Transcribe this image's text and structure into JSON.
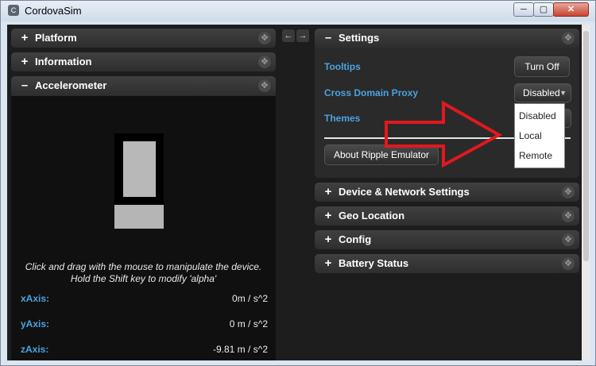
{
  "window": {
    "title": "CordovaSim",
    "minimize": "─",
    "maximize": "▢",
    "close": "✕",
    "app_icon": "C"
  },
  "left_panels": {
    "platform": {
      "label": "Platform",
      "sign": "+"
    },
    "information": {
      "label": "Information",
      "sign": "+"
    },
    "accelerometer": {
      "label": "Accelerometer",
      "sign": "–"
    },
    "drag_glyph": "✥"
  },
  "accelerometer": {
    "hint_line1": "Click and drag with the mouse to manipulate the device.",
    "hint_line2": "Hold the Shift key to modify 'alpha'",
    "x_label": "xAxis:",
    "x_value": "0m / s^2",
    "y_label": "yAxis:",
    "y_value": "0 m / s^2",
    "z_label": "zAxis:",
    "z_value": "-9.81 m / s^2"
  },
  "panel_arrows": {
    "left": "←",
    "right": "→"
  },
  "settings": {
    "label": "Settings",
    "sign": "–",
    "tooltips_label": "Tooltips",
    "tooltips_button": "Turn Off",
    "proxy_label": "Cross Domain Proxy",
    "proxy_selected": "Disabled",
    "themes_label": "Themes",
    "about_button": "About Ripple Emulator",
    "dropdown_options": [
      "Disabled",
      "Local",
      "Remote"
    ]
  },
  "right_panels": [
    {
      "label": "Device & Network Settings",
      "sign": "+"
    },
    {
      "label": "Geo Location",
      "sign": "+"
    },
    {
      "label": "Config",
      "sign": "+"
    },
    {
      "label": "Battery Status",
      "sign": "+"
    }
  ],
  "colors": {
    "accent_label": "#4aa3df",
    "annotation_arrow": "#e0191f"
  },
  "icons": {
    "drag": "move-handle-icon",
    "arrow": "annotation-arrow-icon"
  }
}
